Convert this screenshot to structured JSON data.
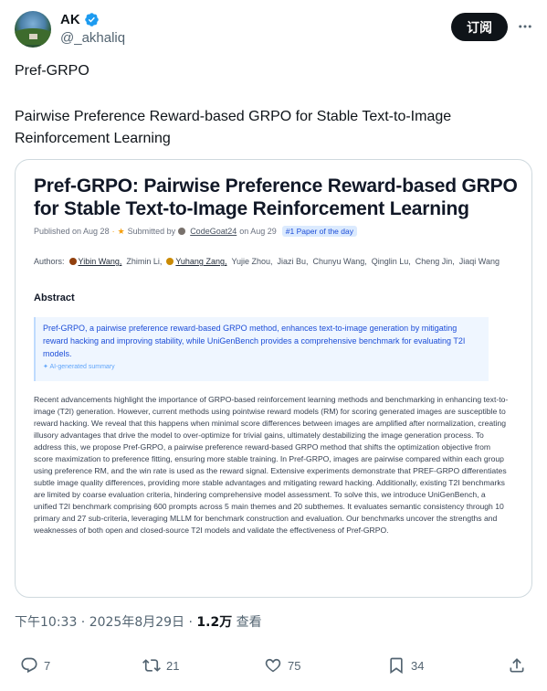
{
  "author": {
    "display_name": "AK",
    "handle": "@_akhaliq",
    "verified_icon": "verified-badge-icon",
    "follow_label": "订阅"
  },
  "tweet": {
    "title": "Pref-GRPO",
    "body": "Pairwise Preference Reward-based GRPO for Stable Text-to-Image Reinforcement Learning"
  },
  "card": {
    "paper_title": "Pref-GRPO: Pairwise Preference Reward-based GRPO for Stable Text-to-Image Reinforcement Learning",
    "published": "Published on Aug 28",
    "submitted_by": "Submitted by",
    "submitter": "CodeGoat24",
    "submitted_date": "on Aug 29",
    "badge": "#1 Paper of the day",
    "authors_label": "Authors:",
    "authors": [
      "Yibin Wang,",
      "Zhimin Li,",
      "Yuhang Zang,",
      "Yujie Zhou,",
      "Jiazi Bu,",
      "Chunyu Wang,",
      "Qinglin Lu,",
      "Cheng Jin,",
      "Jiaqi Wang"
    ],
    "abstract_heading": "Abstract",
    "summary": "Pref-GRPO, a pairwise preference reward-based GRPO method, enhances text-to-image generation by mitigating reward hacking and improving stability, while UniGenBench provides a comprehensive benchmark for evaluating T2I models.",
    "ai_label": "AI-generated summary",
    "abstract": "Recent advancements highlight the importance of GRPO-based reinforcement learning methods and benchmarking in enhancing text-to-image (T2I) generation. However, current methods using pointwise reward models (RM) for scoring generated images are susceptible to reward hacking. We reveal that this happens when minimal score differences between images are amplified after normalization, creating illusory advantages that drive the model to over-optimize for trivial gains, ultimately destabilizing the image generation process. To address this, we propose Pref-GRPO, a pairwise preference reward-based GRPO method that shifts the optimization objective from score maximization to preference fitting, ensuring more stable training. In Pref-GRPO, images are pairwise compared within each group using preference RM, and the win rate is used as the reward signal. Extensive experiments demonstrate that PREF-GRPO differentiates subtle image quality differences, providing more stable advantages and mitigating reward hacking. Additionally, existing T2I benchmarks are limited by coarse evaluation criteria, hindering comprehensive model assessment. To solve this, we introduce UniGenBench, a unified T2I benchmark comprising 600 prompts across 5 main themes and 20 subthemes. It evaluates semantic consistency through 10 primary and 27 sub-criteria, leveraging MLLM for benchmark construction and evaluation. Our benchmarks uncover the strengths and weaknesses of both open and closed-source T2I models and validate the effectiveness of Pref-GRPO."
  },
  "timestamp": {
    "time": "下午10:33 · 2025年8月29日 · ",
    "views": "1.2万",
    "views_label": " 查看"
  },
  "actions": {
    "replies": "7",
    "reposts": "21",
    "likes": "75",
    "bookmarks": "34"
  }
}
